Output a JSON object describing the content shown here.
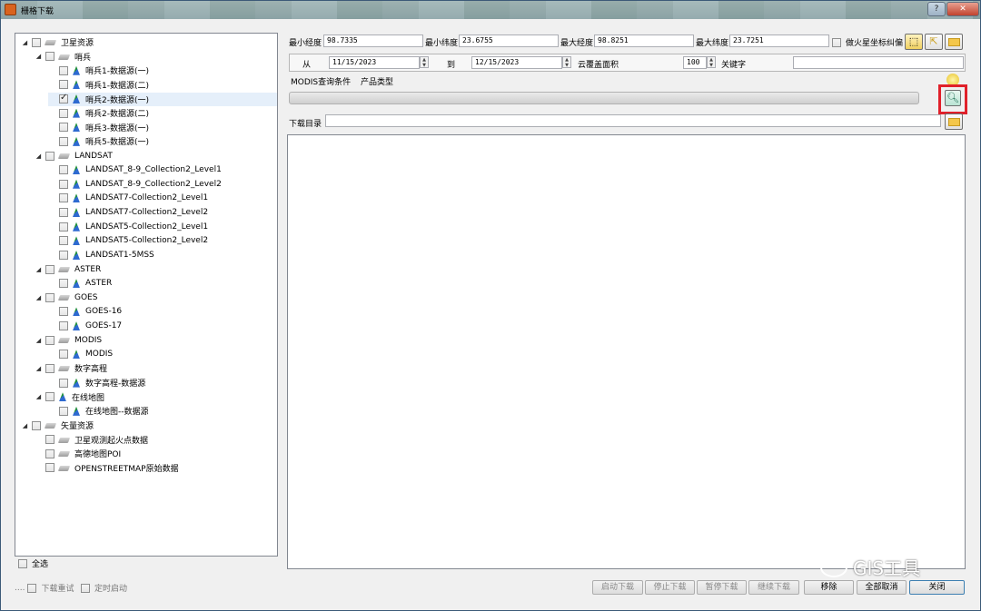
{
  "window": {
    "title": "栅格下载",
    "help": "?",
    "close": "✕"
  },
  "tree": [
    {
      "label": "卫星资源",
      "level": 0,
      "expanded": true,
      "checked": false,
      "icon": "layer-icon"
    },
    {
      "label": "哨兵",
      "level": 1,
      "expanded": true,
      "checked": false,
      "icon": "layer-icon"
    },
    {
      "label": "哨兵1-数据源(一)",
      "level": 2,
      "checked": false,
      "icon": "data-icon"
    },
    {
      "label": "哨兵1-数据源(二)",
      "level": 2,
      "checked": false,
      "icon": "data-icon"
    },
    {
      "label": "哨兵2-数据源(一)",
      "level": 2,
      "checked": true,
      "selected": true,
      "icon": "data-icon"
    },
    {
      "label": "哨兵2-数据源(二)",
      "level": 2,
      "checked": false,
      "icon": "data-icon"
    },
    {
      "label": "哨兵3-数据源(一)",
      "level": 2,
      "checked": false,
      "icon": "data-icon"
    },
    {
      "label": "哨兵5-数据源(一)",
      "level": 2,
      "checked": false,
      "icon": "data-icon"
    },
    {
      "label": "LANDSAT",
      "level": 1,
      "expanded": true,
      "checked": false,
      "icon": "layer-icon"
    },
    {
      "label": "LANDSAT_8-9_Collection2_Level1",
      "level": 2,
      "checked": false,
      "icon": "data-icon"
    },
    {
      "label": "LANDSAT_8-9_Collection2_Level2",
      "level": 2,
      "checked": false,
      "icon": "data-icon"
    },
    {
      "label": "LANDSAT7-Collection2_Level1",
      "level": 2,
      "checked": false,
      "icon": "data-icon"
    },
    {
      "label": "LANDSAT7-Collection2_Level2",
      "level": 2,
      "checked": false,
      "icon": "data-icon"
    },
    {
      "label": "LANDSAT5-Collection2_Level1",
      "level": 2,
      "checked": false,
      "icon": "data-icon"
    },
    {
      "label": "LANDSAT5-Collection2_Level2",
      "level": 2,
      "checked": false,
      "icon": "data-icon"
    },
    {
      "label": "LANDSAT1-5MSS",
      "level": 2,
      "checked": false,
      "icon": "data-icon"
    },
    {
      "label": "ASTER",
      "level": 1,
      "expanded": true,
      "checked": false,
      "icon": "layer-icon"
    },
    {
      "label": "ASTER",
      "level": 2,
      "checked": false,
      "icon": "data-icon"
    },
    {
      "label": "GOES",
      "level": 1,
      "expanded": true,
      "checked": false,
      "icon": "layer-icon"
    },
    {
      "label": "GOES-16",
      "level": 2,
      "checked": false,
      "icon": "data-icon"
    },
    {
      "label": "GOES-17",
      "level": 2,
      "checked": false,
      "icon": "data-icon"
    },
    {
      "label": "MODIS",
      "level": 1,
      "expanded": true,
      "checked": false,
      "icon": "layer-icon"
    },
    {
      "label": "MODIS",
      "level": 2,
      "checked": false,
      "icon": "data-icon"
    },
    {
      "label": "数字高程",
      "level": 1,
      "expanded": true,
      "checked": false,
      "icon": "layer-icon"
    },
    {
      "label": "数字高程-数据源",
      "level": 2,
      "checked": false,
      "icon": "data-icon"
    },
    {
      "label": "在线地图",
      "level": 1,
      "expanded": true,
      "checked": false,
      "icon": "data-icon"
    },
    {
      "label": "在线地图--数据源",
      "level": 2,
      "checked": false,
      "icon": "data-icon"
    },
    {
      "label": "矢量资源",
      "level": 0,
      "expanded": true,
      "checked": false,
      "icon": "layer-icon"
    },
    {
      "label": "卫星观测起火点数据",
      "level": 1,
      "checked": false,
      "icon": "layer-icon"
    },
    {
      "label": "高德地图POI",
      "level": 1,
      "checked": false,
      "icon": "layer-icon"
    },
    {
      "label": "OPENSTREETMAP原始数据",
      "level": 1,
      "checked": false,
      "icon": "layer-icon"
    }
  ],
  "select_all": "全选",
  "bbox": {
    "min_lon_label": "最小经度",
    "min_lon": "98.7335",
    "min_lat_label": "最小纬度",
    "min_lat": "23.6755",
    "max_lon_label": "最大经度",
    "max_lon": "98.8251",
    "max_lat_label": "最大纬度",
    "max_lat": "23.7251",
    "mars_label": "做火星坐标纠偏"
  },
  "query": {
    "from_label": "从",
    "from_date": "11/15/2023",
    "to_label": "到",
    "to_date": "12/15/2023",
    "cloud_label": "云覆盖面积",
    "cloud_value": "100",
    "keyword_label": "关键字",
    "keyword_value": ""
  },
  "modis": {
    "condition_label": "MODIS查询条件",
    "product_label": "产品类型"
  },
  "download_dir_label": "下载目录",
  "bottom": {
    "dots": "....",
    "retry_label": "下载重试",
    "timer_label": "定时启动",
    "start": "启动下载",
    "stop": "停止下载",
    "pause": "暂停下载",
    "resume": "继续下载",
    "remove": "移除",
    "cancel_all": "全部取消",
    "close": "关闭"
  },
  "watermark": "GIS工具"
}
